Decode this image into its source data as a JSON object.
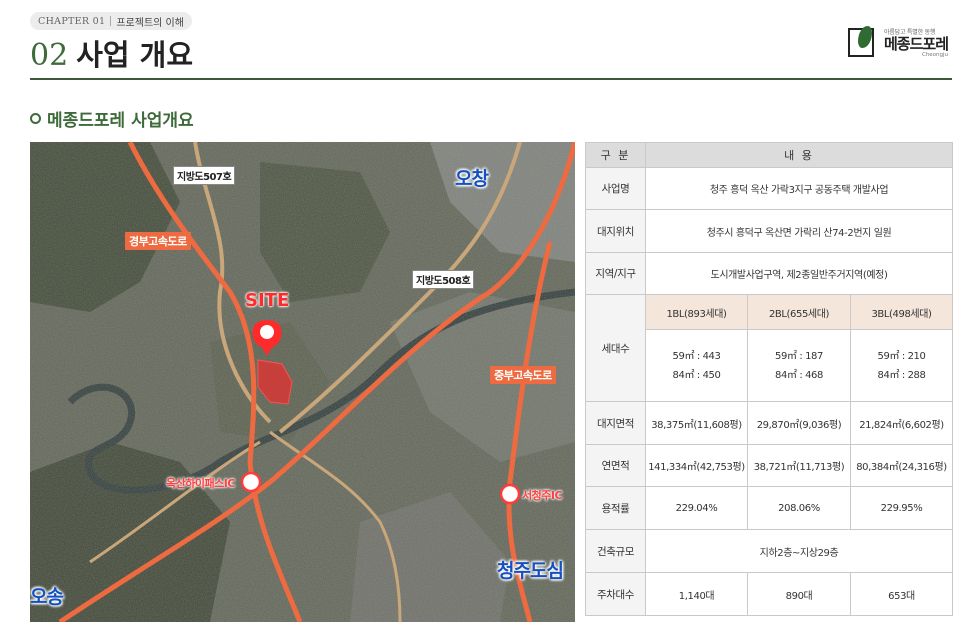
{
  "header": {
    "chapter_en": "CHAPTER 01",
    "chapter_ko": "프로젝트의 이해",
    "title_num": "02",
    "title_text": "사업 개요"
  },
  "logo": {
    "tagline": "아름답고 특별한 동행",
    "name": "메종드포레",
    "en": "Cheongju"
  },
  "section": {
    "title": "메종드포레 사업개요"
  },
  "map": {
    "site_label": "SITE",
    "cities": [
      "오창",
      "청주도심",
      "오송"
    ],
    "roads": [
      "지방도507호",
      "지방도508호"
    ],
    "highways": [
      "경부고속도로",
      "중부고속도로"
    ],
    "interchanges": [
      "옥산하이패스IC",
      "서청주IC"
    ]
  },
  "table": {
    "header": {
      "col1": "구 분",
      "col2": "내 용"
    },
    "rows": {
      "project_name": {
        "label": "사업명",
        "value": "청주 흥덕 옥산 가락3지구 공동주택 개발사업"
      },
      "location": {
        "label": "대지위치",
        "value": "청주시 흥덕구 옥산면 가락리 산74-2번지 일원"
      },
      "zoning": {
        "label": "지역/지구",
        "value": "도시개발사업구역, 제2종일반주거지역(예정)"
      },
      "households": {
        "label": "세대수",
        "blocks": [
          "1BL(893세대)",
          "2BL(655세대)",
          "3BL(498세대)"
        ],
        "line1": [
          "59㎡ : 443",
          "59㎡ : 187",
          "59㎡ : 210"
        ],
        "line2": [
          "84㎡ : 450",
          "84㎡ : 468",
          "84㎡ : 288"
        ]
      },
      "site_area": {
        "label": "대지면적",
        "values": [
          "38,375㎡(11,608평)",
          "29,870㎡(9,036평)",
          "21,824㎡(6,602평)"
        ]
      },
      "floor_area": {
        "label": "연면적",
        "values": [
          "141,334㎡(42,753평)",
          "38,721㎡(11,713평)",
          "80,384㎡(24,316평)"
        ]
      },
      "far": {
        "label": "용적률",
        "values": [
          "229.04%",
          "208.06%",
          "229.95%"
        ]
      },
      "scale": {
        "label": "건축규모",
        "value": "지하2층~지상29층"
      },
      "parking": {
        "label": "주차대수",
        "values": [
          "1,140대",
          "890대",
          "653대"
        ]
      }
    }
  }
}
